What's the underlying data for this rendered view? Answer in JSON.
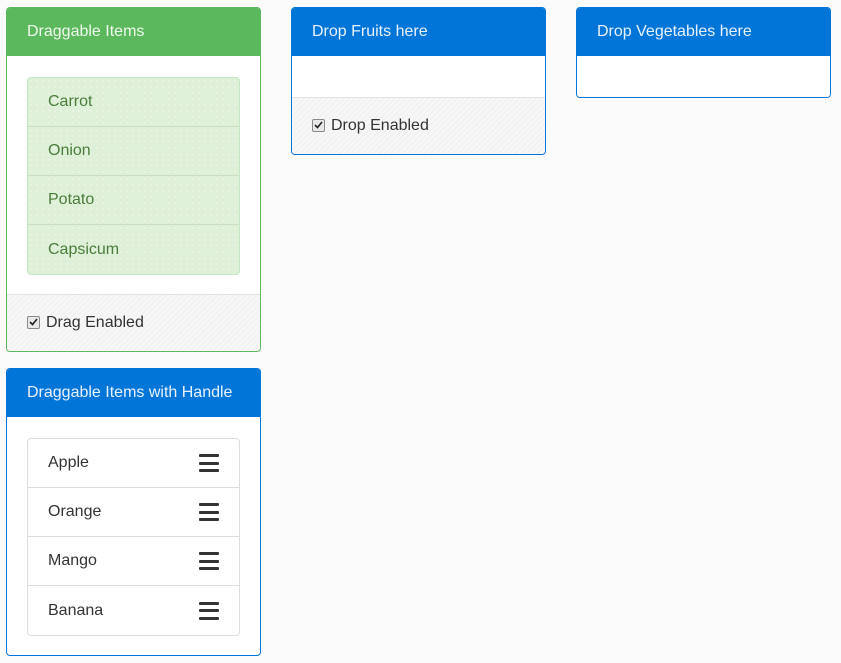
{
  "colors": {
    "primary": "#0275d8",
    "success": "#5cb85c",
    "success_light": "#dff0d8",
    "page_background": "#fbfbfb"
  },
  "draggable_panel": {
    "title": "Draggable Items",
    "items": [
      {
        "label": "Carrot"
      },
      {
        "label": "Onion"
      },
      {
        "label": "Potato"
      },
      {
        "label": "Capsicum"
      }
    ],
    "footer": {
      "checkbox_label": "Drag Enabled",
      "checked": true
    }
  },
  "fruits_panel": {
    "title": "Drop Fruits here",
    "footer": {
      "checkbox_label": "Drop Enabled",
      "checked": true
    }
  },
  "vegetables_panel": {
    "title": "Drop Vegetables here"
  },
  "handle_panel": {
    "title": "Draggable Items with Handle",
    "handle_icon": "hamburger-icon",
    "items": [
      {
        "label": "Apple"
      },
      {
        "label": "Orange"
      },
      {
        "label": "Mango"
      },
      {
        "label": "Banana"
      }
    ]
  }
}
